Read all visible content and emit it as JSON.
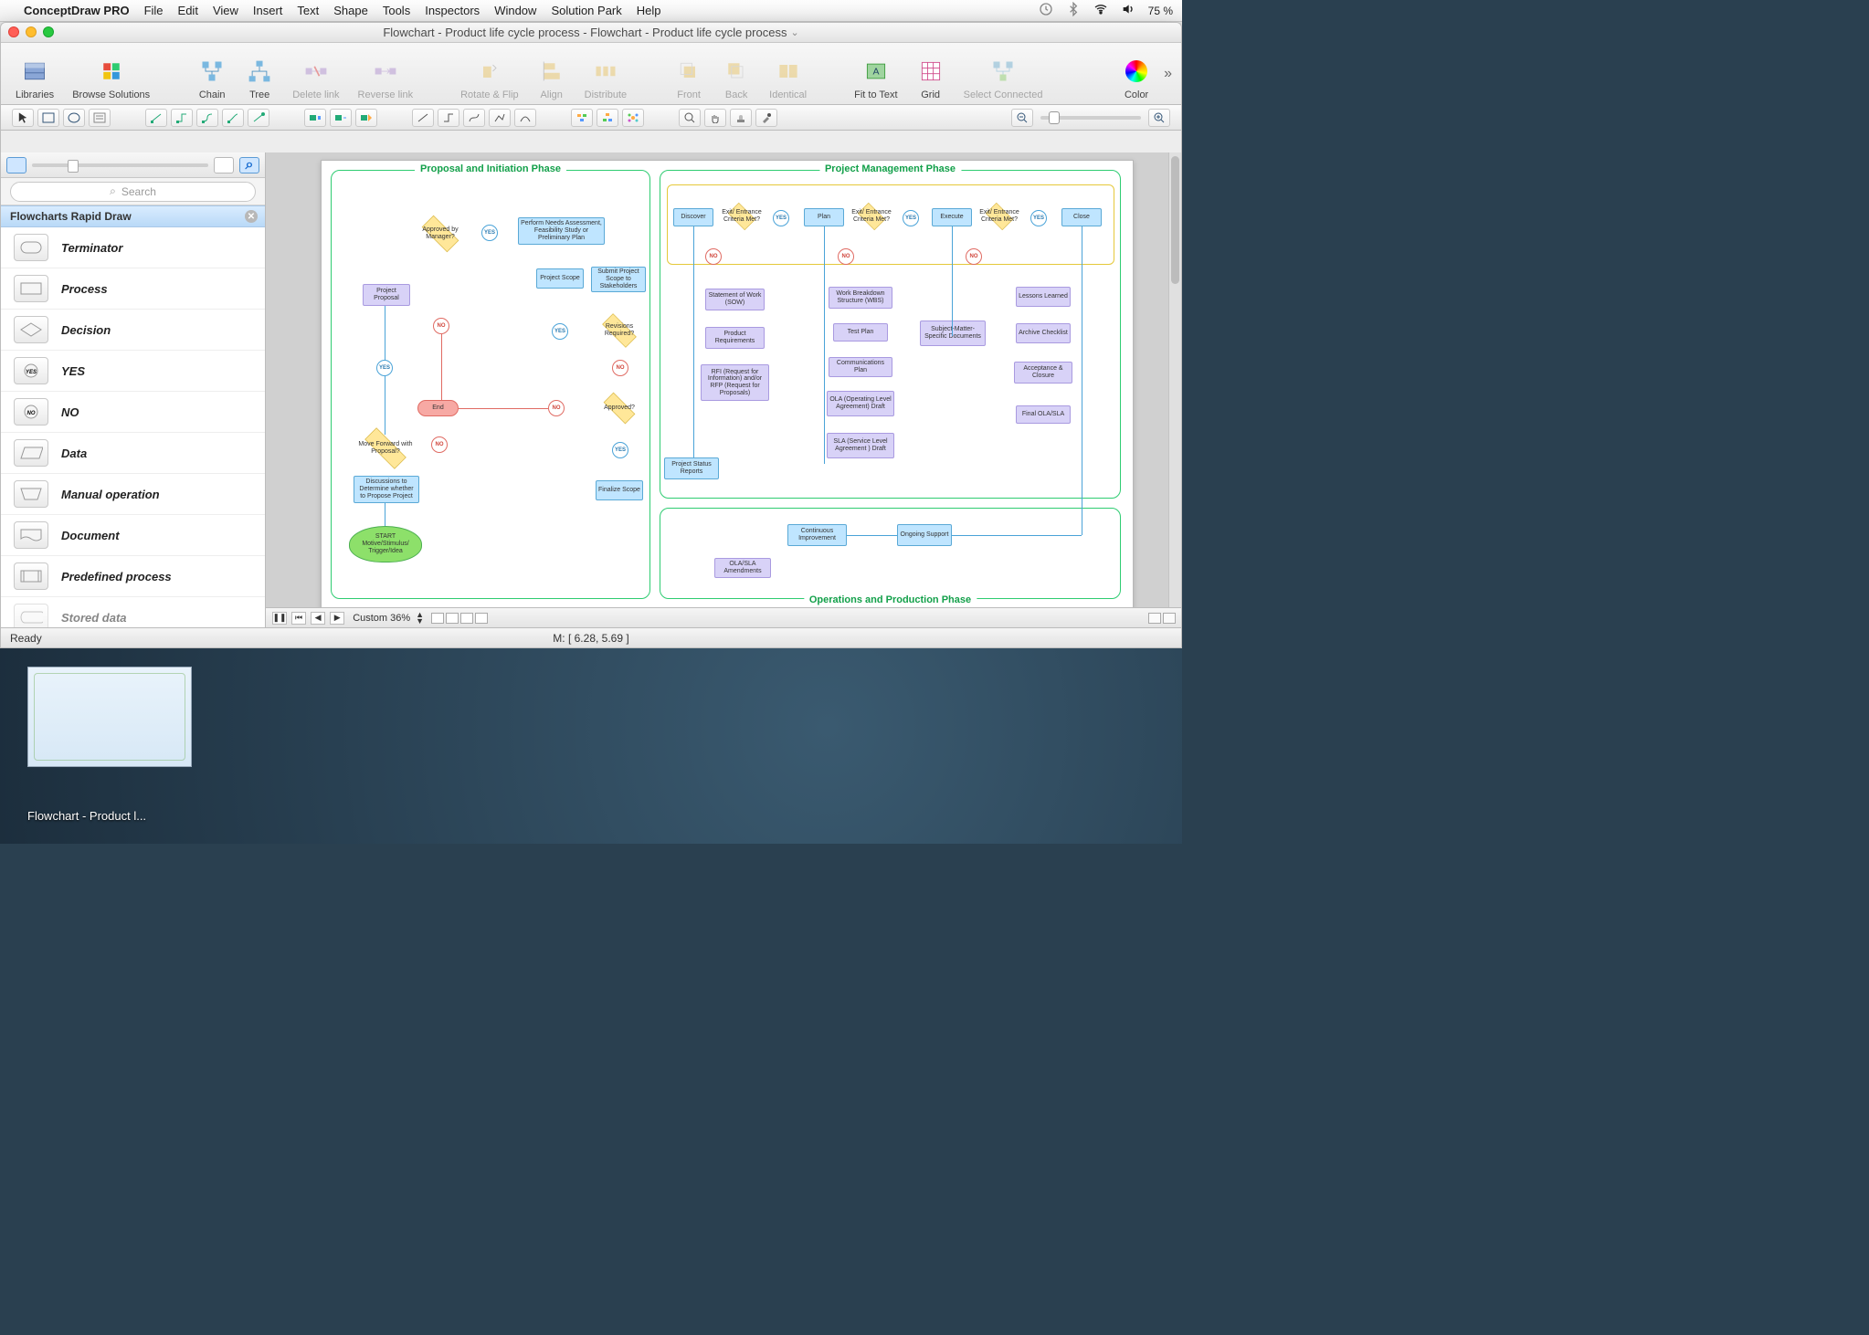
{
  "menubar": {
    "app_name": "ConceptDraw PRO",
    "items": [
      "File",
      "Edit",
      "View",
      "Insert",
      "Text",
      "Shape",
      "Tools",
      "Inspectors",
      "Window",
      "Solution Park",
      "Help"
    ],
    "battery_pct": "75 %"
  },
  "window": {
    "title": "Flowchart - Product life cycle process - Flowchart - Product life cycle process"
  },
  "toolbar": {
    "items": [
      {
        "label": "Libraries",
        "icon": "libraries"
      },
      {
        "label": "Browse Solutions",
        "icon": "solutions"
      },
      {
        "label": "Chain",
        "icon": "chain"
      },
      {
        "label": "Tree",
        "icon": "tree"
      },
      {
        "label": "Delete link",
        "icon": "delete-link",
        "disabled": true
      },
      {
        "label": "Reverse link",
        "icon": "reverse-link",
        "disabled": true
      },
      {
        "label": "Rotate & Flip",
        "icon": "rotate",
        "disabled": true
      },
      {
        "label": "Align",
        "icon": "align",
        "disabled": true
      },
      {
        "label": "Distribute",
        "icon": "distribute",
        "disabled": true
      },
      {
        "label": "Front",
        "icon": "front",
        "disabled": true
      },
      {
        "label": "Back",
        "icon": "back",
        "disabled": true
      },
      {
        "label": "Identical",
        "icon": "identical",
        "disabled": true
      },
      {
        "label": "Fit to Text",
        "icon": "fit-text"
      },
      {
        "label": "Grid",
        "icon": "grid"
      },
      {
        "label": "Select Connected",
        "icon": "select-connected",
        "disabled": true
      },
      {
        "label": "Color",
        "icon": "color"
      }
    ]
  },
  "sidebar": {
    "search_placeholder": "Search",
    "section_title": "Flowcharts Rapid Draw",
    "items": [
      {
        "label": "Terminator",
        "shape": "terminator"
      },
      {
        "label": "Process",
        "shape": "process"
      },
      {
        "label": "Decision",
        "shape": "decision"
      },
      {
        "label": "YES",
        "shape": "yes"
      },
      {
        "label": "NO",
        "shape": "no"
      },
      {
        "label": "Data",
        "shape": "data"
      },
      {
        "label": "Manual operation",
        "shape": "manual"
      },
      {
        "label": "Document",
        "shape": "document"
      },
      {
        "label": "Predefined process",
        "shape": "predefined"
      },
      {
        "label": "Stored data",
        "shape": "stored"
      }
    ]
  },
  "canvas": {
    "phases": {
      "proposal": "Proposal and Initiation Phase",
      "pm": "Project Management Phase",
      "ops": "Operations and Production Phase"
    },
    "nodes": {
      "start": "START Motive/Stimulus/ Trigger/Idea",
      "discuss": "Discussions to Determine whether to Propose Project",
      "forward": "Move Forward with Proposal?",
      "proposal": "Project Proposal",
      "approved": "Approved by Manager?",
      "end": "End",
      "needs": "Perform Needs Assessment, Feasibility Study or Preliminary Plan",
      "scope": "Project Scope",
      "submit": "Submit Project Scope to Stakeholders",
      "revisions": "Revisions Required?",
      "approved2": "Approved?",
      "finalize": "Finalize Scope",
      "discover": "Discover",
      "plan": "Plan",
      "execute": "Execute",
      "close": "Close",
      "crit": "Exit/ Entrance Criteria Met?",
      "yes": "YES",
      "no": "NO",
      "psr": "Project Status Reports",
      "sow": "Statement of Work (SOW)",
      "preq": "Product Requirements",
      "rfi": "RFI (Request for Information) and/or RFP (Request for Proposals)",
      "wbs": "Work Breakdown Structure (WBS)",
      "testplan": "Test Plan",
      "comms": "Communications Plan",
      "ola": "OLA (Operating Level Agreement) Draft",
      "sla": "SLA (Service Level Agreement ) Draft",
      "smd": "Subject-Matter-Specific Documents",
      "lessons": "Lessons Learned",
      "archive": "Archive Checklist",
      "accept": "Acceptance & Closure",
      "finalola": "Final OLA/SLA",
      "ci": "Continuous Improvement",
      "support": "Ongoing Support",
      "amend": "OLA/SLA Amendments"
    }
  },
  "canvas_bar": {
    "zoom_label": "Custom 36%"
  },
  "status": {
    "ready": "Ready",
    "coords": "M: [ 6.28, 5.69 ]"
  },
  "dock": {
    "caption": "Flowchart - Product l..."
  }
}
